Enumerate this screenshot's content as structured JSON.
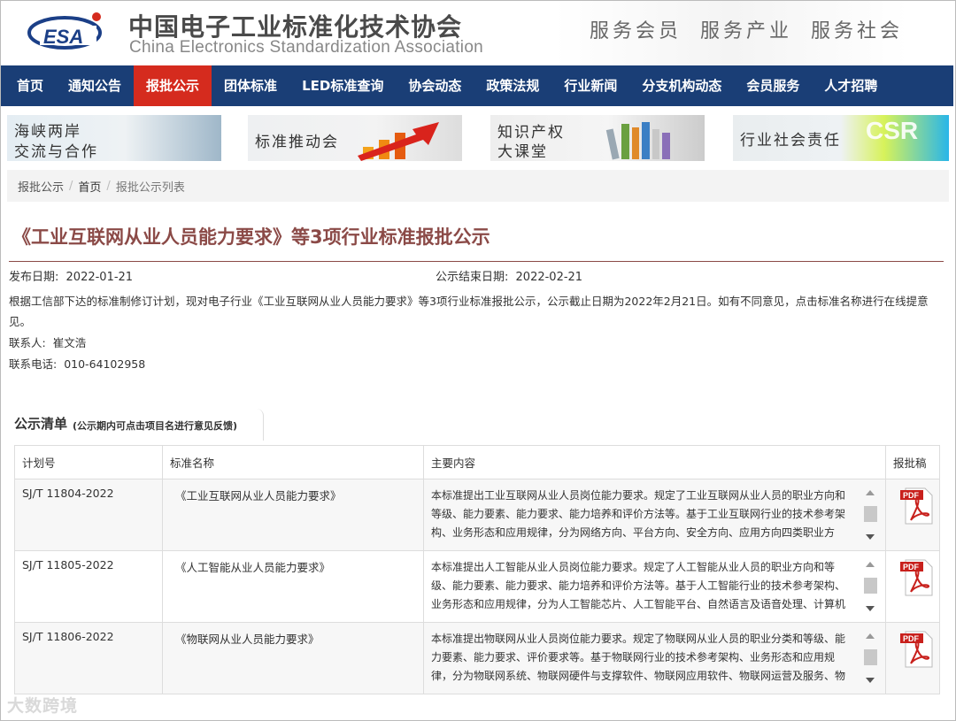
{
  "header": {
    "logo_text": "ESA",
    "org_name_cn": "中国电子工业标准化技术协会",
    "org_name_en": "China Electronics Standardization Association",
    "slogan": "服务会员 服务产业 服务社会"
  },
  "nav": {
    "items": [
      {
        "label": "首页"
      },
      {
        "label": "通知公告"
      },
      {
        "label": "报批公示",
        "active": true
      },
      {
        "label": "团体标准"
      },
      {
        "label": "LED标准查询"
      },
      {
        "label": "协会动态"
      },
      {
        "label": "政策法规"
      },
      {
        "label": "行业新闻"
      },
      {
        "label": "分支机构动态"
      },
      {
        "label": "会员服务"
      },
      {
        "label": "人才招聘"
      }
    ],
    "colors": {
      "bar": "#1a3e76",
      "active": "#d52b1e"
    }
  },
  "banners": [
    {
      "line1": "海峡两岸",
      "line2": "交流与合作"
    },
    {
      "line1": "标准推动会",
      "line2": ""
    },
    {
      "line1": "知识产权",
      "line2": "大课堂"
    },
    {
      "line1": "行业社会责任",
      "line2": "CSR"
    }
  ],
  "breadcrumb": [
    "报批公示",
    "首页",
    "报批公示列表"
  ],
  "article": {
    "title": "《工业互联网从业人员能力要求》等3项行业标准报批公示",
    "publish_label": "发布日期:",
    "publish_date": "2022-01-21",
    "end_label": "公示结束日期:",
    "end_date": "2022-02-21",
    "description": "根据工信部下达的标准制修订计划，现对电子行业《工业互联网从业人员能力要求》等3项行业标准报批公示，公示截止日期为2022年2月21日。如有不同意见，点击标准名称进行在线提意见。",
    "contact_label": "联系人:",
    "contact_name": "崔文浩",
    "phone_label": "联系电话:",
    "phone": "010-64102958"
  },
  "list": {
    "title": "公示清单",
    "subtitle": "(公示期内可点击项目名进行意见反馈)",
    "columns": [
      "计划号",
      "标准名称",
      "主要内容",
      "报批稿"
    ],
    "rows": [
      {
        "plan_no": "SJ/T 11804-2022",
        "name": "《工业互联网从业人员能力要求》",
        "content": "本标准提出工业互联网从业人员岗位能力要求。规定了工业互联网从业人员的职业方向和等级、能力要素、能力要求、能力培养和评价方法等。基于工业互联网行业的技术参考架构、业务形态和应用规律，分为网络方向、平台方向、安全方向、应用方向四类职业方向，在职业方向划分的基础上，根据工业互联网行业发展的基础",
        "file": "PDF"
      },
      {
        "plan_no": "SJ/T 11805-2022",
        "name": "《人工智能从业人员能力要求》",
        "content": "本标准提出人工智能从业人员岗位能力要求。规定了人工智能从业人员的职业方向和等级、能力要素、能力要求、能力培养和评价方法等。基于人工智能行业的技术参考架构、业务形态和应用规律，分为人工智能芯片、人工智能平台、自然语言及语音处理、计算机视觉、人工智能应用集成五类职业方向，在职业方向划分的基础",
        "file": "PDF"
      },
      {
        "plan_no": "SJ/T 11806-2022",
        "name": "《物联网从业人员能力要求》",
        "content": "本标准提出物联网从业人员岗位能力要求。规定了物联网从业人员的职业分类和等级、能力要素、能力要求、评价要求等。基于物联网行业的技术参考架构、业务形态和应用规律，分为物联网系统、物联网硬件与支撑软件、物联网应用软件、物联网运营及服务、物联网测试五类岗位方向，在岗位划分的基础上，根据物联网行业",
        "file": "PDF"
      }
    ]
  },
  "watermark": "大数跨境"
}
